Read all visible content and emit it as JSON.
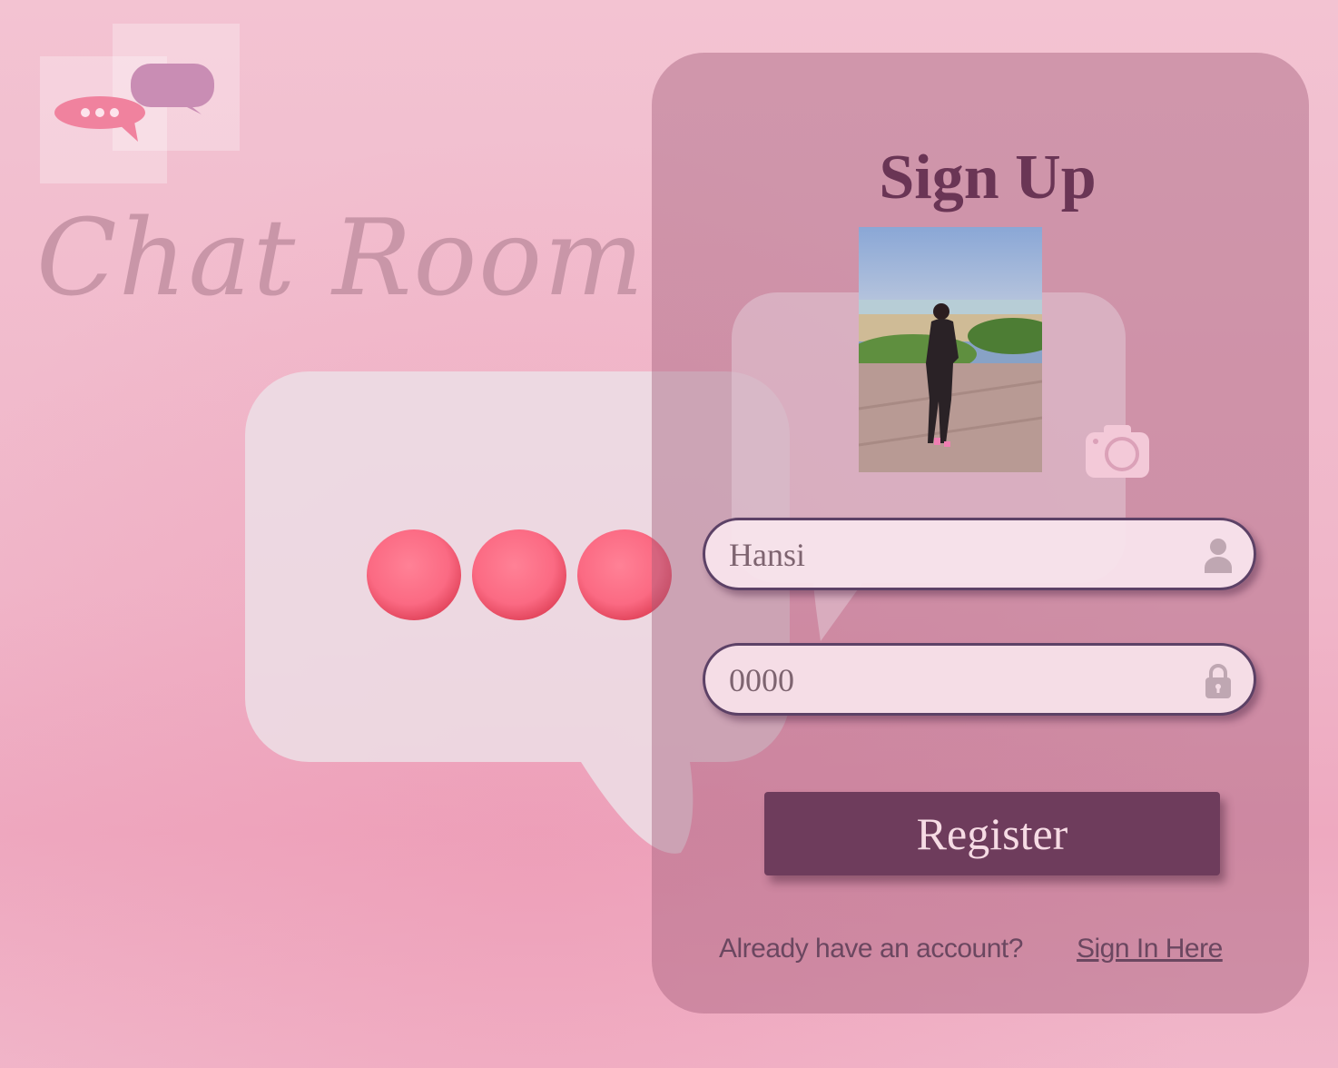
{
  "app": {
    "title": "Chat Room"
  },
  "signup": {
    "title": "Sign Up",
    "username_value": "Hansi",
    "password_value": "0000",
    "register_label": "Register",
    "footer_text": "Already have an account?",
    "signin_link": "Sign In Here"
  },
  "icons": [
    "chat-logo-icon",
    "camera-icon",
    "user-icon",
    "lock-icon"
  ],
  "colors": {
    "background": "#f1bdcf",
    "card": "#c792a8",
    "accent": "#6e3c5c",
    "title_text": "#6a3555",
    "dots": "#fb6c85"
  }
}
